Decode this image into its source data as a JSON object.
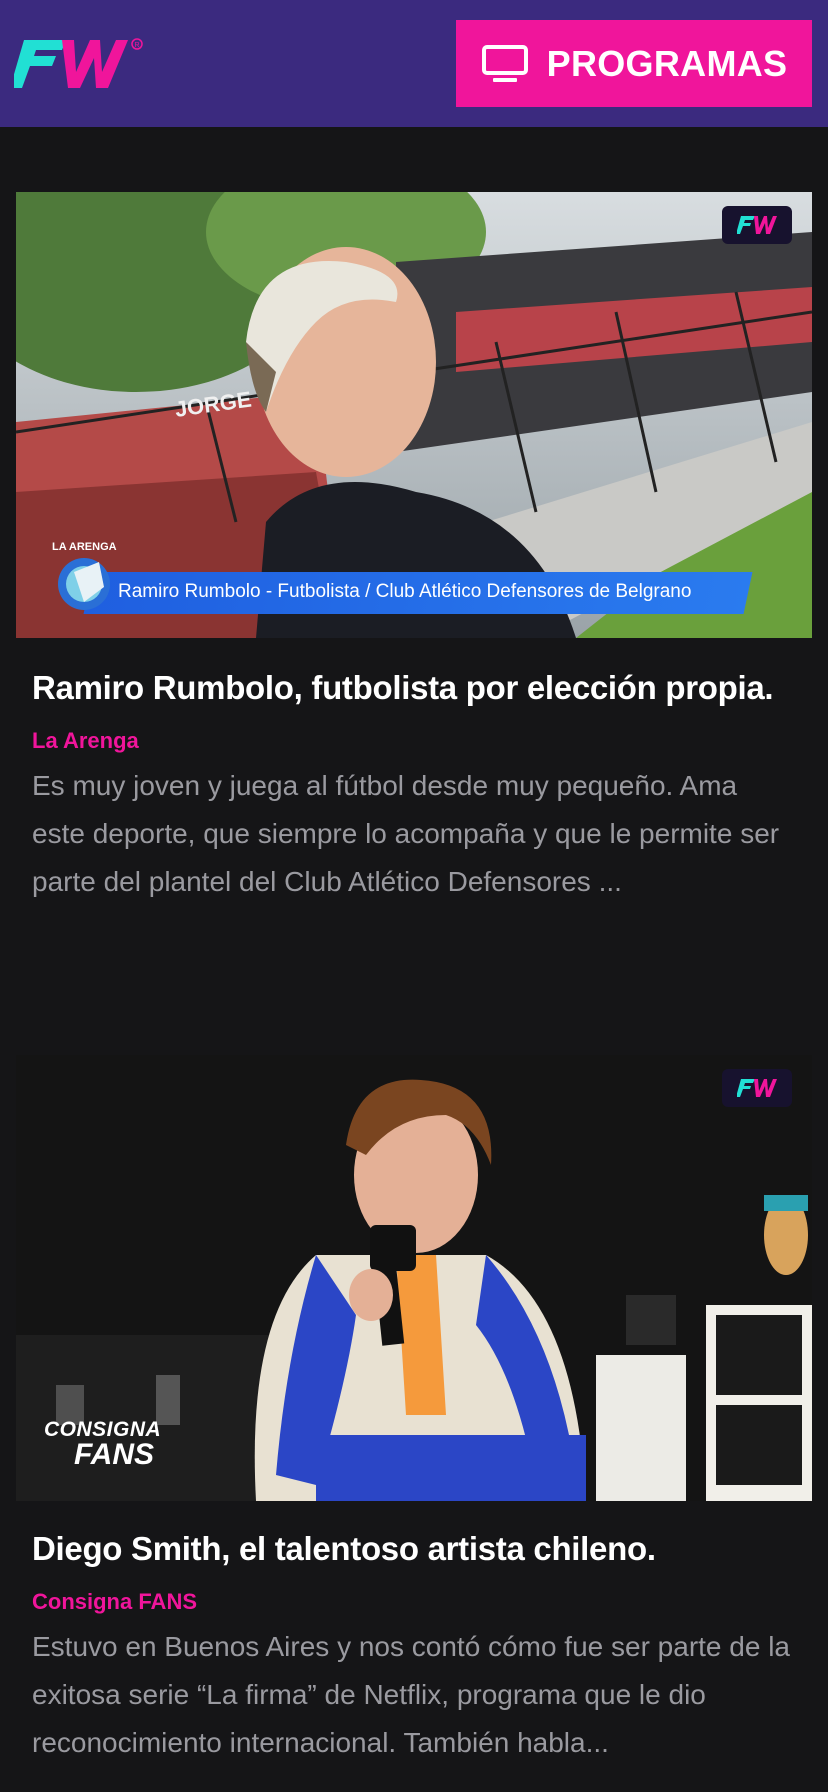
{
  "header": {
    "logo_text": "FW",
    "programs_button_label": "PROGRAMAS",
    "programs_icon": "tv-icon"
  },
  "brand_colors": {
    "header_bg": "#3b2a7f",
    "accent_pink": "#f0159b",
    "logo_cyan": "#21e0d4",
    "page_bg": "#151517"
  },
  "articles": [
    {
      "video_caption": "Ramiro Rumbolo - Futbolista / Club Atlético Defensores de Belgrano",
      "show_logo_text": "LA ARENGA",
      "title": "Ramiro Rumbolo, futbolista por elección propia.",
      "program": "La Arenga",
      "description": "Es muy joven y juega al fútbol desde muy pequeño. Ama este deporte, que siempre lo acompaña y que le permite ser parte del plantel del Club Atlético Defensores ..."
    },
    {
      "show_logo_line1": "CONSIGNA",
      "show_logo_line2": "FANS",
      "title": "Diego Smith, el talentoso artista chileno.",
      "program": "Consigna FANS",
      "description": "Estuvo en Buenos Aires y nos contó cómo fue ser parte de la exitosa serie “La firma” de Netflix, programa que le dio reconocimiento internacional. También habla..."
    }
  ]
}
